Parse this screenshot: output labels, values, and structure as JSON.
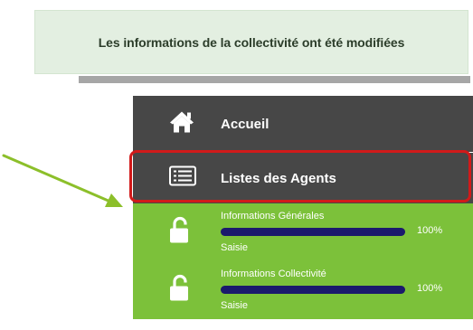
{
  "notification": {
    "message": "Les informations de la collectivité ont été modifiées"
  },
  "menu": {
    "home": {
      "label": "Accueil",
      "icon": "home-icon"
    },
    "agents": {
      "label": "Listes des Agents",
      "icon": "list-icon"
    },
    "progress_items": [
      {
        "title": "Informations Générales",
        "percent_label": "100%",
        "status": "Saisie",
        "progress": 1.0,
        "icon": "unlock-icon"
      },
      {
        "title": "Informations Collectivité",
        "percent_label": "100%",
        "status": "Saisie",
        "progress": 1.0,
        "icon": "unlock-icon"
      }
    ]
  },
  "colors": {
    "banner_bg": "#e3efe1",
    "menu_dark": "#474747",
    "menu_green": "#7cc13a",
    "progress_fill": "#1b1a6c",
    "highlight": "#d11a1a",
    "arrow": "#8cbf2a"
  }
}
